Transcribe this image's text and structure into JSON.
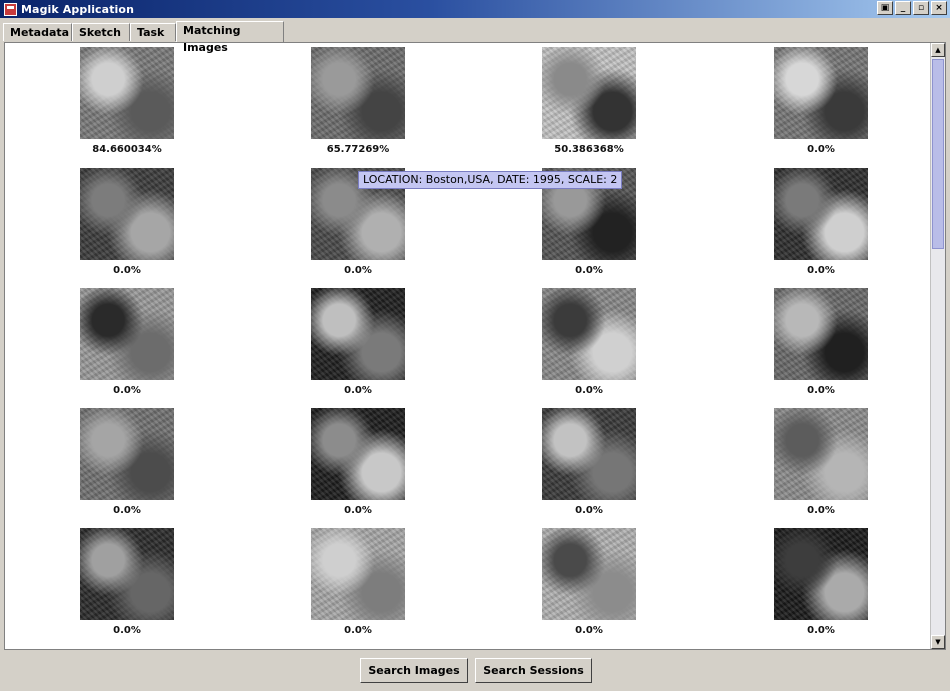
{
  "window": {
    "title": "Magik Application"
  },
  "tabs": [
    "Metadata",
    "Sketch",
    "Task",
    "Matching Images"
  ],
  "active_tab": "Matching Images",
  "tooltip": "LOCATION: Boston,USA, DATE: 1995, SCALE: 2",
  "results": [
    {
      "score": "84.660034%"
    },
    {
      "score": "65.77269%"
    },
    {
      "score": "50.386368%"
    },
    {
      "score": "0.0%"
    },
    {
      "score": "0.0%"
    },
    {
      "score": "0.0%"
    },
    {
      "score": "0.0%"
    },
    {
      "score": "0.0%"
    },
    {
      "score": "0.0%"
    },
    {
      "score": "0.0%"
    },
    {
      "score": "0.0%"
    },
    {
      "score": "0.0%"
    },
    {
      "score": "0.0%"
    },
    {
      "score": "0.0%"
    },
    {
      "score": "0.0%"
    },
    {
      "score": "0.0%"
    },
    {
      "score": "0.0%"
    },
    {
      "score": "0.0%"
    },
    {
      "score": "0.0%"
    },
    {
      "score": "0.0%"
    }
  ],
  "buttons": {
    "search_images": "Search Images",
    "search_sessions": "Search Sessions"
  }
}
